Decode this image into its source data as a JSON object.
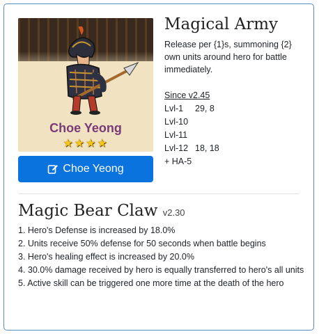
{
  "hero": {
    "name": "Choe Yeong",
    "stars": 4,
    "star_glyph": "★",
    "button_label": "Choe Yeong",
    "button_icon": "edit-icon"
  },
  "skill": {
    "title": "Magical Army",
    "description": "Release per {1}s, summoning {2} own units around hero for battle immediately.",
    "since": "Since v2.45",
    "levels": [
      {
        "level": "Lvl-1",
        "value": "29, 8"
      },
      {
        "level": "Lvl-10",
        "value": ""
      },
      {
        "level": "Lvl-11",
        "value": ""
      },
      {
        "level": "Lvl-12",
        "value": "18, 18"
      }
    ],
    "extra": "+ HA-5"
  },
  "treasure": {
    "title": "Magic Bear Claw",
    "version": "v2.30",
    "effects": [
      "1. Hero's Defense is increased by 18.0%",
      "2. Units receive 50% defense for 50 seconds when battle begins",
      "3. Hero's healing effect is increased by 20.0%",
      "4. 30.0% damage received by hero is equally transferred to hero's all units",
      "5. Active skill can be triggered one more time at the death of the hero"
    ]
  },
  "colors": {
    "card_border": "#5a8fbf",
    "button_bg": "#0a73de",
    "hero_name": "#7a3a78",
    "star": "#f5c518"
  }
}
